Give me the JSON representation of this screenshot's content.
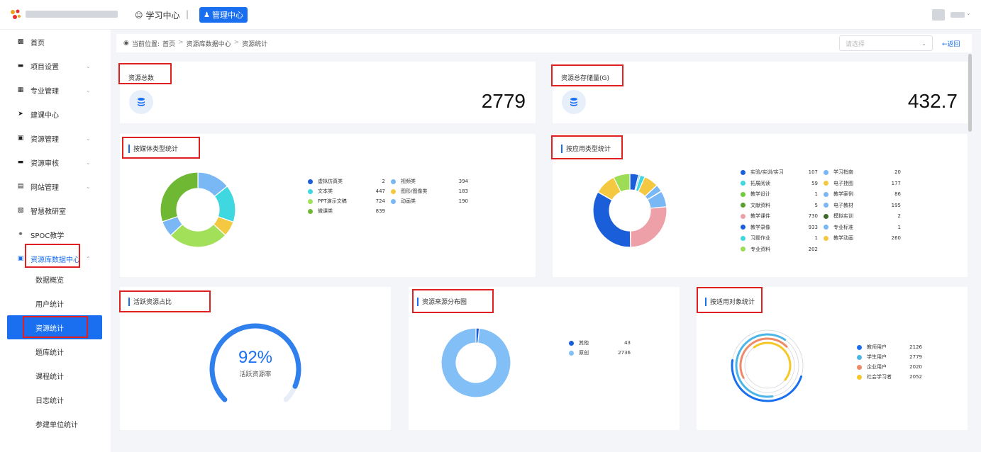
{
  "topbar": {
    "study_center": "学习中心",
    "separator": "|",
    "admin_center": "管理中心"
  },
  "sidebar": {
    "items": [
      {
        "label": "首页",
        "icon": "building-icon"
      },
      {
        "label": "项目设置",
        "icon": "folder-icon"
      },
      {
        "label": "专业管理",
        "icon": "book-icon"
      },
      {
        "label": "建课中心",
        "icon": "send-icon"
      },
      {
        "label": "资源管理",
        "icon": "lock-icon"
      },
      {
        "label": "资源审核",
        "icon": "folder-icon"
      },
      {
        "label": "网站管理",
        "icon": "monitor-icon"
      },
      {
        "label": "智慧教研室",
        "icon": "document-icon"
      },
      {
        "label": "SPOC教学",
        "icon": "link-icon"
      },
      {
        "label": "资源库数据中心",
        "icon": "image-icon"
      }
    ],
    "subitems": [
      "数据概览",
      "用户统计",
      "资源统计",
      "题库统计",
      "课程统计",
      "日志统计",
      "参建单位统计"
    ]
  },
  "breadcrumb": {
    "prefix": "当前位置:",
    "home": "首页",
    "sep": ">",
    "parent": "资源库数据中心",
    "current": "资源统计"
  },
  "select": {
    "placeholder": "请选择"
  },
  "back": "←返回",
  "cards": {
    "total": {
      "title": "资源总数",
      "value": "2779"
    },
    "storage": {
      "title": "资源总存储量(G)",
      "value": "432.7"
    },
    "media": {
      "title": "按媒体类型统计"
    },
    "app": {
      "title": "按应用类型统计"
    },
    "active": {
      "title": "活跃资源占比",
      "percent": "92%",
      "label": "活跃资源率"
    },
    "source": {
      "title": "资源来源分布图"
    },
    "audience": {
      "title": "按适用对象统计"
    }
  },
  "chart_data": [
    {
      "type": "pie",
      "title": "按媒体类型统计",
      "labels": [
        "虚拟仿真类",
        "视频类",
        "文本类",
        "图形/图像类",
        "PPT演示文稿",
        "动画类",
        "微课类"
      ],
      "values": [
        2,
        394,
        447,
        183,
        724,
        190,
        839
      ],
      "colors": [
        "#1a5fd9",
        "#7ab7f5",
        "#40d8e0",
        "#f5c842",
        "#a3e05a",
        "#7ab7f5",
        "#6fb834"
      ]
    },
    {
      "type": "pie",
      "title": "按应用类型统计",
      "labels": [
        "实验/实训/实习",
        "学习指南",
        "拓展阅读",
        "电子挂图",
        "教学设计",
        "教学案例",
        "文献资料",
        "电子教材",
        "教学课件",
        "模拟实训",
        "教学录像",
        "专业标准",
        "习题作业",
        "教学动画",
        "专业资料"
      ],
      "values": [
        107,
        20,
        59,
        177,
        1,
        86,
        5,
        195,
        730,
        2,
        933,
        1,
        1,
        260,
        202
      ],
      "colors": [
        "#1a5fd9",
        "#7ab7f5",
        "#40d8e0",
        "#f5c842",
        "#6fcc3c",
        "#7ab7f5",
        "#5aa02c",
        "#7ab7f5",
        "#eda0a8",
        "#3f6b2a",
        "#1a5fd9",
        "#7ab7f5",
        "#40d8e0",
        "#f5c842",
        "#9ddc55"
      ]
    },
    {
      "type": "gauge",
      "title": "活跃资源占比",
      "value": 92,
      "unit": "%"
    },
    {
      "type": "pie",
      "title": "资源来源分布图",
      "labels": [
        "其他",
        "原创"
      ],
      "values": [
        43,
        2736
      ],
      "colors": [
        "#1a5fd9",
        "#82bff7"
      ]
    },
    {
      "type": "radial-bar",
      "title": "按适用对象统计",
      "labels": [
        "教师用户",
        "学生用户",
        "企业用户",
        "社会学习者"
      ],
      "values": [
        2126,
        2779,
        2020,
        2052
      ],
      "colors": [
        "#1a6ff0",
        "#4bb5e8",
        "#ee8a66",
        "#f5c82a"
      ]
    }
  ]
}
